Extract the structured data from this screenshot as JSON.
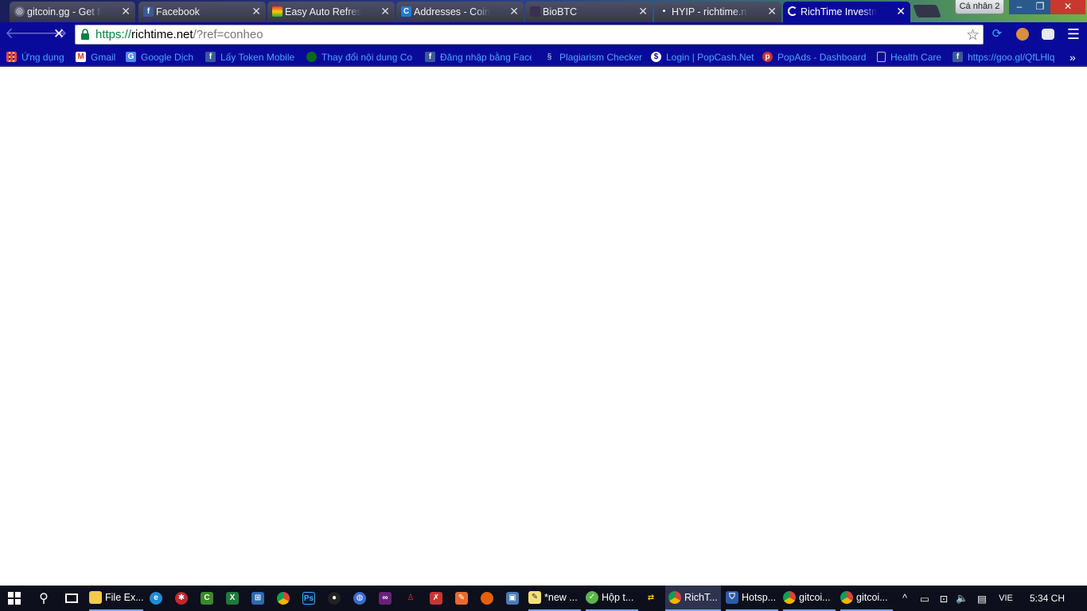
{
  "window": {
    "profile_label": "Cá nhân 2",
    "minimize": "–",
    "maximize": "❐",
    "close": "✕"
  },
  "tabs": [
    {
      "title": "gitcoin.gg - Get free",
      "favicon": "gitcoin-icon",
      "active": false
    },
    {
      "title": "Facebook",
      "favicon": "facebook-icon",
      "active": false
    },
    {
      "title": "Easy Auto Refresh -",
      "favicon": "easy-auto-refresh-icon",
      "active": false
    },
    {
      "title": "Addresses - Coinbase",
      "favicon": "coinbase-icon",
      "active": false
    },
    {
      "title": "BioBTC",
      "favicon": "biobtc-icon",
      "active": false
    },
    {
      "title": "HYIP - richtime.net",
      "favicon": "hyip-icon",
      "active": false
    },
    {
      "title": "RichTime Investment",
      "favicon": "loading-spinner-icon",
      "active": true
    }
  ],
  "toolbar": {
    "back": "🡐",
    "forward": "🡒",
    "stop": "✕",
    "url_scheme": "https://",
    "url_host": "richtime.net",
    "url_path": "/?ref=conheo",
    "star": "☆"
  },
  "bookmarks": [
    {
      "label": "Ứng dụng",
      "icon": "apps-grid-icon"
    },
    {
      "label": "Gmail",
      "icon": "gmail-icon"
    },
    {
      "label": "Google Dịch",
      "icon": "google-translate-icon"
    },
    {
      "label": "Lấy Token Mobile",
      "icon": "facebook-icon"
    },
    {
      "label": "Thay đổi nội dung Co",
      "icon": "green-circle-icon"
    },
    {
      "label": "Đăng nhập bằng Face",
      "icon": "facebook-icon"
    },
    {
      "label": "Plagiarism Checker",
      "icon": "plagiarism-icon"
    },
    {
      "label": "Login | PopCash.Net",
      "icon": "popcash-icon"
    },
    {
      "label": "PopAds - Dashboard",
      "icon": "popads-icon"
    },
    {
      "label": "Health Care",
      "icon": "page-icon"
    },
    {
      "label": "https://goo.gl/QfLHlq",
      "icon": "facebook-icon"
    }
  ],
  "bookmarks_overflow": "»",
  "taskbar": {
    "items": [
      {
        "label": "File Ex...",
        "icon": "file-explorer-icon"
      },
      {
        "label": "*new ...",
        "icon": "notepad-icon"
      },
      {
        "label": "Hộp t...",
        "icon": "mail-icon"
      },
      {
        "label": "RichT...",
        "icon": "chrome-icon"
      },
      {
        "label": "Hotsp...",
        "icon": "shield-icon"
      },
      {
        "label": "gitcoi...",
        "icon": "chrome-icon"
      },
      {
        "label": "gitcoi...",
        "icon": "chrome-icon"
      }
    ],
    "language": "VIE",
    "time": "5:34 CH",
    "tray_chevron": "^"
  },
  "colors": {
    "chrome_bg": "#0a0a9a",
    "link_blue": "#4ea2ff",
    "taskbar": "#0d0f1c"
  }
}
